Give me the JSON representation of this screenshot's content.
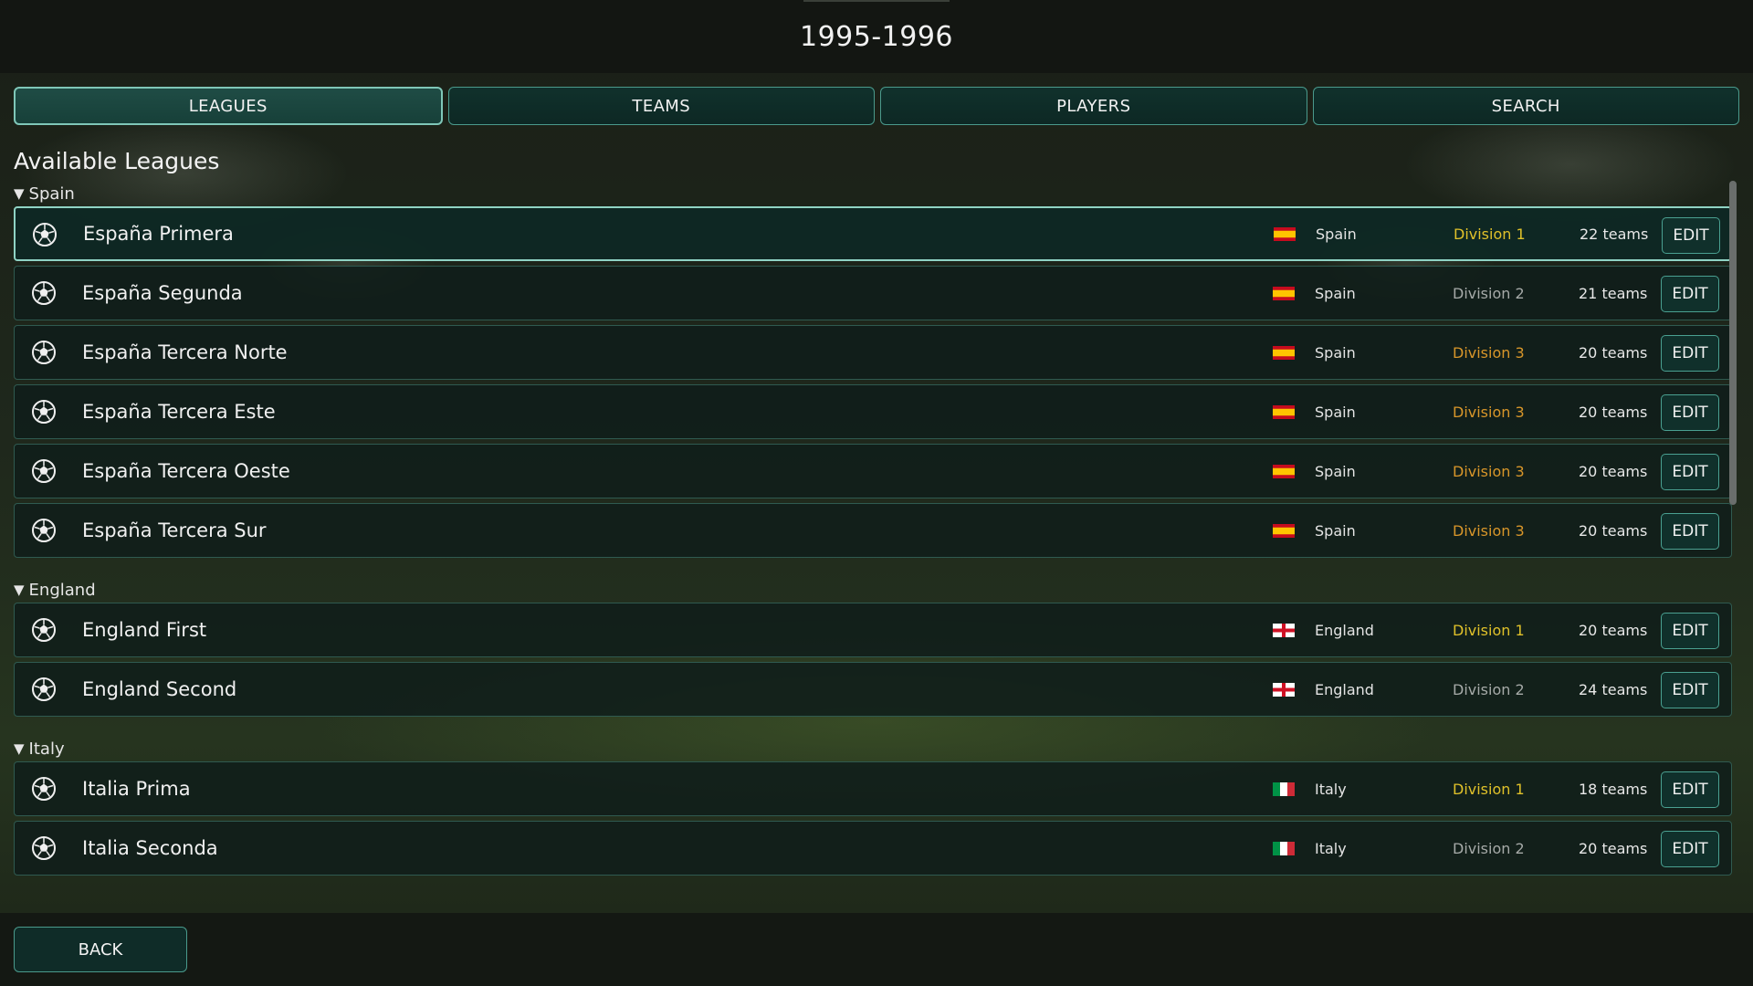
{
  "header": {
    "title": "1995-1996"
  },
  "tabs": [
    {
      "label": "LEAGUES",
      "active": true
    },
    {
      "label": "TEAMS",
      "active": false
    },
    {
      "label": "PLAYERS",
      "active": false
    },
    {
      "label": "SEARCH",
      "active": false
    }
  ],
  "section_title": "Available Leagues",
  "groups": [
    {
      "label": "Spain",
      "leagues": [
        {
          "name": "España Primera",
          "country": "Spain",
          "flag": "spain-flag",
          "division": "Division 1",
          "teams": "22 teams",
          "edit_label": "EDIT",
          "selected": true
        },
        {
          "name": "España Segunda",
          "country": "Spain",
          "flag": "spain-flag",
          "division": "Division 2",
          "teams": "21 teams",
          "edit_label": "EDIT"
        },
        {
          "name": "España Tercera Norte",
          "country": "Spain",
          "flag": "spain-flag",
          "division": "Division 3",
          "teams": "20 teams",
          "edit_label": "EDIT"
        },
        {
          "name": "España Tercera Este",
          "country": "Spain",
          "flag": "spain-flag",
          "division": "Division 3",
          "teams": "20 teams",
          "edit_label": "EDIT"
        },
        {
          "name": "España Tercera Oeste",
          "country": "Spain",
          "flag": "spain-flag",
          "division": "Division 3",
          "teams": "20 teams",
          "edit_label": "EDIT"
        },
        {
          "name": "España Tercera Sur",
          "country": "Spain",
          "flag": "spain-flag",
          "division": "Division 3",
          "teams": "20 teams",
          "edit_label": "EDIT"
        }
      ]
    },
    {
      "label": "England",
      "leagues": [
        {
          "name": "England First",
          "country": "England",
          "flag": "england-flag",
          "division": "Division 1",
          "teams": "20 teams",
          "edit_label": "EDIT"
        },
        {
          "name": "England Second",
          "country": "England",
          "flag": "england-flag",
          "division": "Division 2",
          "teams": "24 teams",
          "edit_label": "EDIT"
        }
      ]
    },
    {
      "label": "Italy",
      "leagues": [
        {
          "name": "Italia Prima",
          "country": "Italy",
          "flag": "italy-flag",
          "division": "Division 1",
          "teams": "18 teams",
          "edit_label": "EDIT"
        },
        {
          "name": "Italia Seconda",
          "country": "Italy",
          "flag": "italy-flag",
          "division": "Division 2",
          "teams": "20 teams",
          "edit_label": "EDIT"
        }
      ]
    }
  ],
  "division_colors": {
    "Division 1": "#e0c12a",
    "Division 2": "#a6aaa8",
    "Division 3": "#d8962a"
  },
  "footer": {
    "back_label": "BACK"
  }
}
